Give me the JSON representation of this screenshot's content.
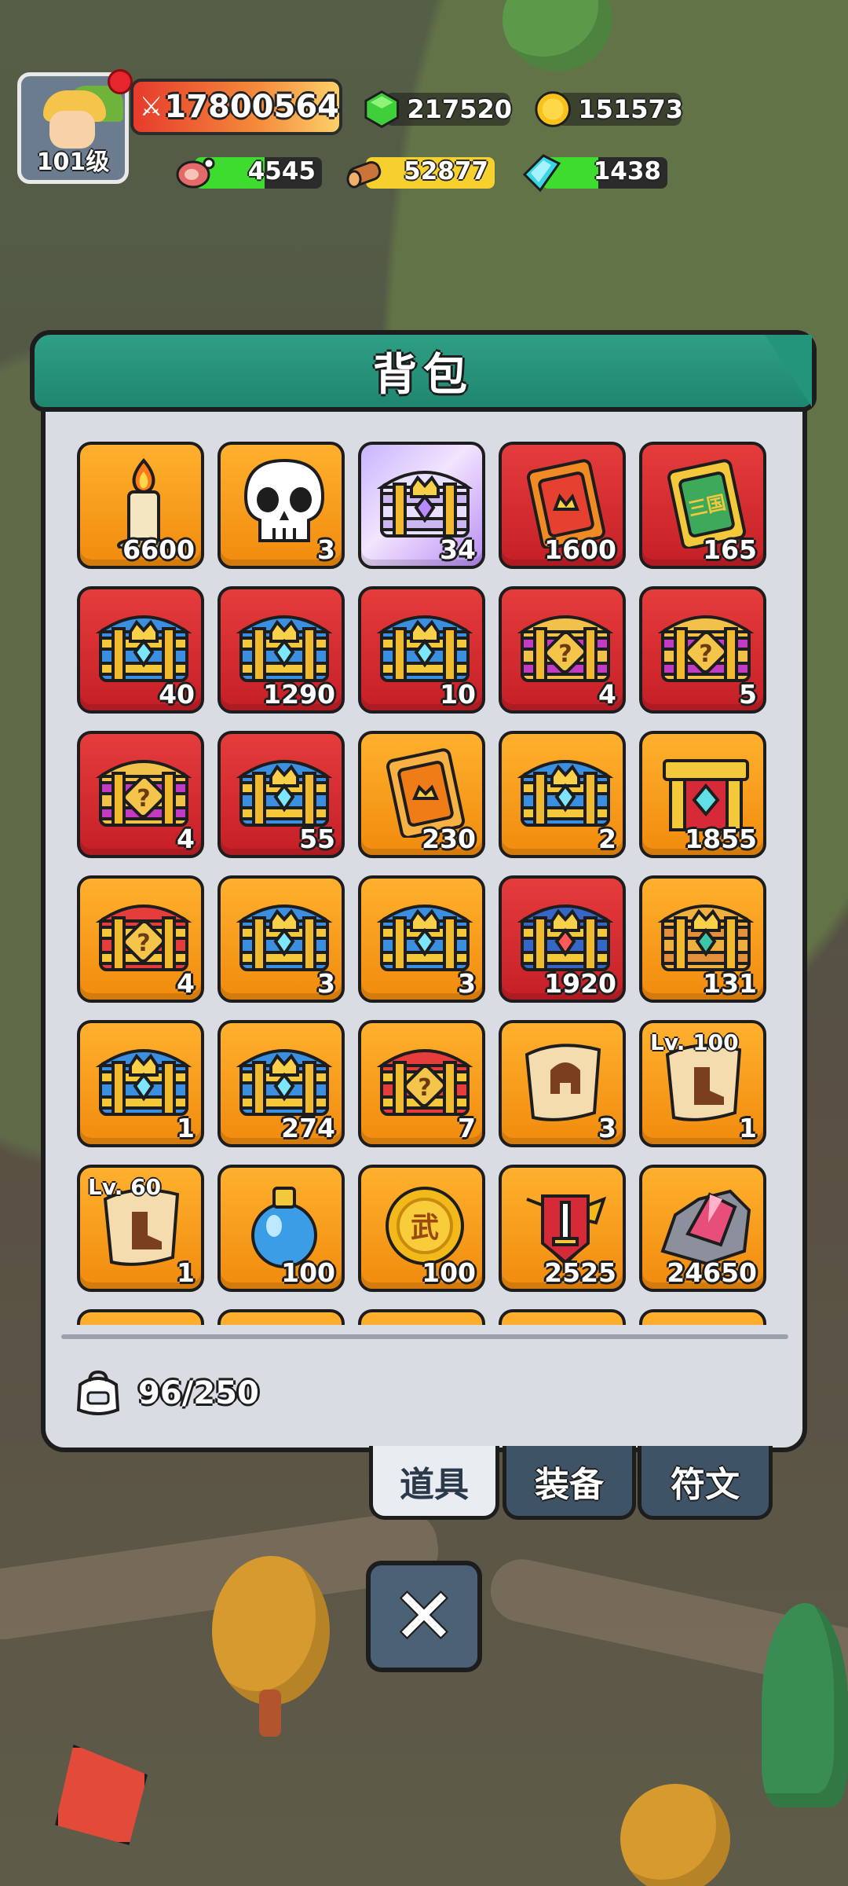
{
  "player": {
    "level_label": "101级",
    "power": "17800564"
  },
  "top_resources": [
    {
      "name": "gem",
      "icon": "green-gem-icon",
      "value": "217520"
    },
    {
      "name": "gold",
      "icon": "gold-coin-icon",
      "value": "151573"
    }
  ],
  "bar_resources": [
    {
      "name": "meat",
      "icon": "meat-icon",
      "value": "4545",
      "fill": 0.55,
      "color": "#3ddc2f"
    },
    {
      "name": "wood",
      "icon": "wood-log-icon",
      "value": "52877",
      "fill": 1.0,
      "color": "#f6d02c"
    },
    {
      "name": "crystal",
      "icon": "crystal-icon",
      "value": "1438",
      "fill": 0.45,
      "color": "#3ddc2f"
    }
  ],
  "panel": {
    "title": "背包",
    "capacity": "96/250"
  },
  "tabs": [
    {
      "label": "道具",
      "active": true
    },
    {
      "label": "装备",
      "active": false
    },
    {
      "label": "符文",
      "active": false
    }
  ],
  "items": [
    {
      "icon": "candle-icon",
      "count": "6600",
      "bg": "orange"
    },
    {
      "icon": "skull-icon",
      "count": "3",
      "bg": "orange"
    },
    {
      "icon": "silver-chest-icon",
      "count": "34",
      "bg": "purple"
    },
    {
      "icon": "red-card-icon",
      "count": "1600",
      "bg": "red"
    },
    {
      "icon": "green-card-icon",
      "count": "165",
      "bg": "red",
      "card_text": "三国"
    },
    {
      "icon": "blue-chest-icon",
      "count": "40",
      "bg": "red"
    },
    {
      "icon": "blue-chest-icon",
      "count": "1290",
      "bg": "red"
    },
    {
      "icon": "blue-chest-icon",
      "count": "10",
      "bg": "red"
    },
    {
      "icon": "mystery-chest-icon",
      "count": "4",
      "bg": "red"
    },
    {
      "icon": "mystery-chest-icon",
      "count": "5",
      "bg": "red"
    },
    {
      "icon": "mystery-chest-icon",
      "count": "4",
      "bg": "red"
    },
    {
      "icon": "blue-chest-icon",
      "count": "55",
      "bg": "red"
    },
    {
      "icon": "orange-card-icon",
      "count": "230",
      "bg": "orange"
    },
    {
      "icon": "blue-chest-icon",
      "count": "2",
      "bg": "orange"
    },
    {
      "icon": "red-gift-chest-icon",
      "count": "1855",
      "bg": "orange"
    },
    {
      "icon": "red-mystery-chest-icon",
      "count": "4",
      "bg": "orange"
    },
    {
      "icon": "blue-chest-icon",
      "count": "3",
      "bg": "orange"
    },
    {
      "icon": "blue-chest-icon",
      "count": "3",
      "bg": "orange"
    },
    {
      "icon": "royal-chest-icon",
      "count": "1920",
      "bg": "red"
    },
    {
      "icon": "ornate-chest-icon",
      "count": "131",
      "bg": "orange"
    },
    {
      "icon": "blue-chest-icon",
      "count": "1",
      "bg": "orange"
    },
    {
      "icon": "blue-chest-icon",
      "count": "274",
      "bg": "orange"
    },
    {
      "icon": "red-mystery-chest-icon",
      "count": "7",
      "bg": "orange"
    },
    {
      "icon": "helmet-scroll-icon",
      "count": "3",
      "bg": "orange"
    },
    {
      "icon": "boot-scroll-icon",
      "count": "1",
      "bg": "orange",
      "lv": "Lv. 100"
    },
    {
      "icon": "boot-scroll-icon",
      "count": "1",
      "bg": "orange",
      "lv": "Lv. 60"
    },
    {
      "icon": "potion-icon",
      "count": "100",
      "bg": "orange"
    },
    {
      "icon": "wu-coin-icon",
      "count": "100",
      "bg": "orange",
      "coin_text": "武"
    },
    {
      "icon": "sword-badge-icon",
      "count": "2525",
      "bg": "orange"
    },
    {
      "icon": "ore-icon",
      "count": "24650",
      "bg": "orange"
    },
    {
      "icon": "partial-item-icon",
      "count": "",
      "bg": "orange"
    },
    {
      "icon": "partial-item-icon",
      "count": "",
      "bg": "orange"
    },
    {
      "icon": "partial-item-icon",
      "count": "",
      "bg": "orange"
    },
    {
      "icon": "partial-item-icon",
      "count": "",
      "bg": "orange"
    },
    {
      "icon": "partial-item-icon",
      "count": "",
      "bg": "orange"
    }
  ],
  "close_button": {
    "icon": "close-icon",
    "symbol": "✕"
  }
}
